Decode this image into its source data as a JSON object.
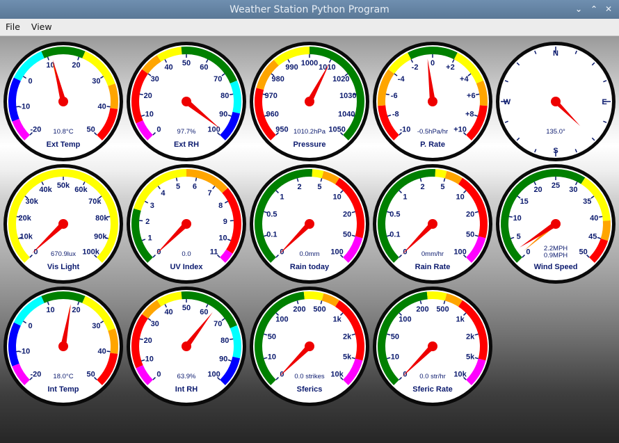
{
  "window": {
    "title": "Weather Station Python Program",
    "controls": [
      "chevron-down-icon",
      "chevron-up-icon",
      "close-icon"
    ]
  },
  "menu": {
    "file": "File",
    "view": "View"
  },
  "gauges": [
    {
      "title": "Ext Temp",
      "value_text": "10.8°C",
      "ticks": [
        "-20",
        "-10",
        "0",
        "10",
        "20",
        "30",
        "40",
        "50"
      ],
      "min": -25,
      "max": 55,
      "value": 10.8,
      "aux_value": 10.4,
      "bands": [
        [
          "#ff00ff",
          -25,
          -18
        ],
        [
          "#0000ff",
          -18,
          -4
        ],
        [
          "#00ffff",
          -4,
          8
        ],
        [
          "#008000",
          8,
          22
        ],
        [
          "#ffff00",
          22,
          36
        ],
        [
          "#ffa500",
          36,
          44
        ],
        [
          "#ff0000",
          44,
          55
        ]
      ]
    },
    {
      "title": "Ext RH",
      "value_text": "97.7%",
      "ticks": [
        "0",
        "10",
        "20",
        "30",
        "40",
        "50",
        "60",
        "70",
        "80",
        "90",
        "100"
      ],
      "min": 0,
      "max": 100,
      "value": 97.7,
      "bands": [
        [
          "#ff00ff",
          0,
          8
        ],
        [
          "#ff0000",
          8,
          30
        ],
        [
          "#ffa500",
          30,
          38
        ],
        [
          "#ffff00",
          38,
          48
        ],
        [
          "#008000",
          48,
          75
        ],
        [
          "#00ffff",
          75,
          88
        ],
        [
          "#0000ff",
          88,
          100
        ]
      ]
    },
    {
      "title": "Pressure",
      "value_text": "1010.2hPa",
      "ticks": [
        "950",
        "960",
        "970",
        "980",
        "990",
        "1000",
        "1010",
        "1020",
        "1030",
        "1040",
        "1050"
      ],
      "min": 950,
      "max": 1050,
      "value": 1010.2,
      "bands": [
        [
          "#ff0000",
          950,
          972
        ],
        [
          "#ffa500",
          972,
          985
        ],
        [
          "#ffff00",
          985,
          1000
        ],
        [
          "#008000",
          1000,
          1050
        ]
      ]
    },
    {
      "title": "P. Rate",
      "value_text": "-0.5hPa/hr",
      "ticks": [
        "-10",
        "-8",
        "-6",
        "-4",
        "-2",
        "0",
        "+2",
        "+4",
        "+6",
        "+8",
        "+10"
      ],
      "min": -10,
      "max": 10,
      "value": -0.5,
      "bands": [
        [
          "#ff0000",
          -10,
          -7
        ],
        [
          "#ffa500",
          -7,
          -4
        ],
        [
          "#ffff00",
          -4,
          -2
        ],
        [
          "#008000",
          -2,
          2
        ],
        [
          "#ffff00",
          2,
          5
        ],
        [
          "#ffa500",
          5,
          7
        ],
        [
          "#ff0000",
          7,
          10
        ]
      ]
    },
    {
      "title": "",
      "value_text": "135.0°",
      "compass": true,
      "ticks": [
        "N",
        "E",
        "S",
        "W"
      ],
      "min": 0,
      "max": 360,
      "value": 135.0,
      "bands": []
    },
    {
      "title": "Vis Light",
      "value_text": "670.9lux",
      "ticks": [
        "0",
        "10k",
        "20k",
        "30k",
        "40k",
        "50k",
        "60k",
        "70k",
        "80k",
        "90k",
        "100k"
      ],
      "min": 0,
      "max": 100000,
      "value": 670.9,
      "bands": [
        [
          "#ffff00",
          0,
          100000
        ]
      ]
    },
    {
      "title": "UV Index",
      "value_text": "0.0",
      "ticks": [
        "0",
        "1",
        "2",
        "3",
        "4",
        "5",
        "6",
        "7",
        "8",
        "9",
        "10",
        "11"
      ],
      "min": 0,
      "max": 11,
      "value": 0.0,
      "bands": [
        [
          "#008000",
          0,
          2.5
        ],
        [
          "#ffff00",
          2.5,
          5.5
        ],
        [
          "#ffa500",
          5.5,
          7.5
        ],
        [
          "#ff0000",
          7.5,
          10.5
        ],
        [
          "#ff00ff",
          10.5,
          11
        ]
      ]
    },
    {
      "title": "Rain today",
      "value_text": "0.0mm",
      "ticks": [
        "0",
        "0.1",
        "0.5",
        "1",
        "2",
        "5",
        "10",
        "20",
        "50",
        "100"
      ],
      "min": 0,
      "max": 9,
      "value": 0,
      "bands": [
        [
          "#008000",
          0,
          4.6
        ],
        [
          "#ffff00",
          4.6,
          5
        ],
        [
          "#ffa500",
          5,
          5.6
        ],
        [
          "#ff0000",
          5.6,
          8
        ],
        [
          "#ff00ff",
          8,
          9
        ]
      ]
    },
    {
      "title": "Rain Rate",
      "value_text": "0mm/hr",
      "ticks": [
        "0",
        "0.1",
        "0.5",
        "1",
        "2",
        "5",
        "10",
        "20",
        "50",
        "100"
      ],
      "min": 0,
      "max": 9,
      "value": 0,
      "bands": [
        [
          "#008000",
          0,
          4.6
        ],
        [
          "#ffff00",
          4.6,
          5
        ],
        [
          "#ffa500",
          5,
          5.6
        ],
        [
          "#ff0000",
          5.6,
          8
        ],
        [
          "#ff00ff",
          8,
          9
        ]
      ]
    },
    {
      "title": "Wind Speed",
      "value_text": "2.2MPH",
      "value_text2": "0.9MPH",
      "ticks": [
        "0",
        "5",
        "10",
        "15",
        "20",
        "25",
        "30",
        "35",
        "40",
        "45",
        "50"
      ],
      "min": 0,
      "max": 50,
      "value": 2.2,
      "aux_value": 0.9,
      "bands": [
        [
          "#008000",
          0,
          31
        ],
        [
          "#ffff00",
          31,
          41
        ],
        [
          "#ffa500",
          41,
          45
        ],
        [
          "#ff0000",
          45,
          50
        ]
      ]
    },
    {
      "title": "Int Temp",
      "value_text": "18.0°C",
      "ticks": [
        "-20",
        "-10",
        "0",
        "10",
        "20",
        "30",
        "40",
        "50"
      ],
      "min": -25,
      "max": 55,
      "value": 18.0,
      "aux_value": 17.8,
      "bands": [
        [
          "#ff00ff",
          -25,
          -18
        ],
        [
          "#0000ff",
          -18,
          -4
        ],
        [
          "#00ffff",
          -4,
          8
        ],
        [
          "#008000",
          8,
          22
        ],
        [
          "#ffff00",
          22,
          36
        ],
        [
          "#ffa500",
          36,
          44
        ],
        [
          "#ff0000",
          44,
          55
        ]
      ]
    },
    {
      "title": "Int RH",
      "value_text": "63.9%",
      "ticks": [
        "0",
        "10",
        "20",
        "30",
        "40",
        "50",
        "60",
        "70",
        "80",
        "90",
        "100"
      ],
      "min": 0,
      "max": 100,
      "value": 63.9,
      "bands": [
        [
          "#ff00ff",
          0,
          8
        ],
        [
          "#ff0000",
          8,
          30
        ],
        [
          "#ffa500",
          30,
          38
        ],
        [
          "#ffff00",
          38,
          48
        ],
        [
          "#008000",
          48,
          75
        ],
        [
          "#00ffff",
          75,
          88
        ],
        [
          "#0000ff",
          88,
          100
        ]
      ]
    },
    {
      "title": "Sferics",
      "value_text": "0.0 strikes",
      "ticks": [
        "0",
        "10",
        "50",
        "100",
        "200",
        "500",
        "1k",
        "2k",
        "5k",
        "10k"
      ],
      "min": 0,
      "max": 9,
      "value": 0,
      "bands": [
        [
          "#008000",
          0,
          4.3
        ],
        [
          "#ffff00",
          4.3,
          5
        ],
        [
          "#ffa500",
          5,
          5.6
        ],
        [
          "#ff0000",
          5.6,
          8
        ],
        [
          "#ff00ff",
          8,
          9
        ]
      ]
    },
    {
      "title": "Sferic Rate",
      "value_text": "0.0 str/hr",
      "ticks": [
        "0",
        "10",
        "50",
        "100",
        "200",
        "500",
        "1k",
        "2k",
        "5k",
        "10k"
      ],
      "min": 0,
      "max": 9,
      "value": 0,
      "bands": [
        [
          "#008000",
          0,
          4.3
        ],
        [
          "#ffff00",
          4.3,
          5
        ],
        [
          "#ffa500",
          5,
          5.6
        ],
        [
          "#ff0000",
          5.6,
          8
        ],
        [
          "#ff00ff",
          8,
          9
        ]
      ]
    }
  ]
}
